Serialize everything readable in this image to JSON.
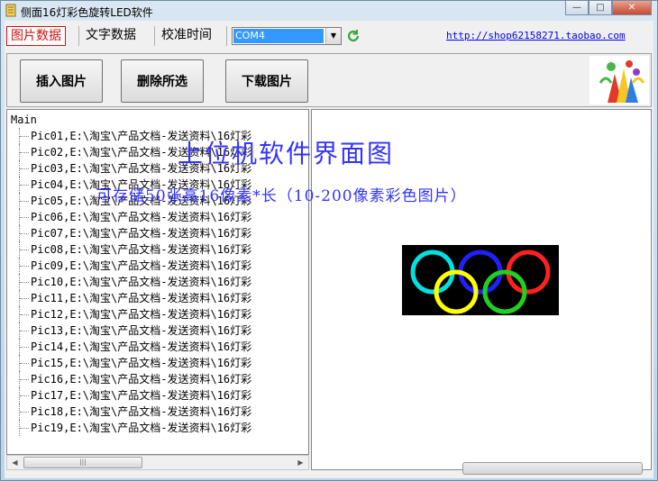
{
  "window": {
    "title": "侧面16灯彩色旋转LED软件",
    "min_icon": "minimize-icon",
    "max_icon": "maximize-icon",
    "close_icon": "close-icon",
    "min_glyph": "—",
    "max_glyph": "□",
    "close_glyph": "✕"
  },
  "tabs": [
    {
      "label": "图片数据",
      "active": true
    },
    {
      "label": "文字数据",
      "active": false
    },
    {
      "label": "校准时间",
      "active": false
    }
  ],
  "port": {
    "selected": "COM4",
    "arrow": "▼"
  },
  "shop_link": "http://shop62158271.taobao.com",
  "toolbar": {
    "insert_label": "插入图片",
    "delete_label": "删除所选",
    "download_label": "下载图片"
  },
  "tree": {
    "root": "Main",
    "items": [
      "Pic01,E:\\淘宝\\产品文档-发送资料\\16灯彩",
      "Pic02,E:\\淘宝\\产品文档-发送资料\\16灯彩",
      "Pic03,E:\\淘宝\\产品文档-发送资料\\16灯彩",
      "Pic04,E:\\淘宝\\产品文档-发送资料\\16灯彩",
      "Pic05,E:\\淘宝\\产品文档-发送资料\\16灯彩",
      "Pic06,E:\\淘宝\\产品文档-发送资料\\16灯彩",
      "Pic07,E:\\淘宝\\产品文档-发送资料\\16灯彩",
      "Pic08,E:\\淘宝\\产品文档-发送资料\\16灯彩",
      "Pic09,E:\\淘宝\\产品文档-发送资料\\16灯彩",
      "Pic10,E:\\淘宝\\产品文档-发送资料\\16灯彩",
      "Pic11,E:\\淘宝\\产品文档-发送资料\\16灯彩",
      "Pic12,E:\\淘宝\\产品文档-发送资料\\16灯彩",
      "Pic13,E:\\淘宝\\产品文档-发送资料\\16灯彩",
      "Pic14,E:\\淘宝\\产品文档-发送资料\\16灯彩",
      "Pic15,E:\\淘宝\\产品文档-发送资料\\16灯彩",
      "Pic16,E:\\淘宝\\产品文档-发送资料\\16灯彩",
      "Pic17,E:\\淘宝\\产品文档-发送资料\\16灯彩",
      "Pic18,E:\\淘宝\\产品文档-发送资料\\16灯彩",
      "Pic19,E:\\淘宝\\产品文档-发送资料\\16灯彩"
    ]
  },
  "scrollbar": {
    "left": "◀",
    "right": "▶",
    "grip": "|||"
  },
  "captions": {
    "line1": "上位机软件界面图",
    "line2": "可存储50张高16像素*长（10-200像素彩色图片）"
  },
  "colors": {
    "caption": "#3333ff",
    "active_tab": "#d01010",
    "selection": "#3399ff",
    "ring_cyan": "#00e0e0",
    "ring_blue": "#2020ff",
    "ring_red": "#ff2020",
    "ring_yellow": "#ffff00",
    "ring_green": "#20d020"
  },
  "icons": {
    "app": "app-icon",
    "refresh": "refresh-icon",
    "logo": "logo-icon",
    "preview": "olympic-rings-image"
  }
}
